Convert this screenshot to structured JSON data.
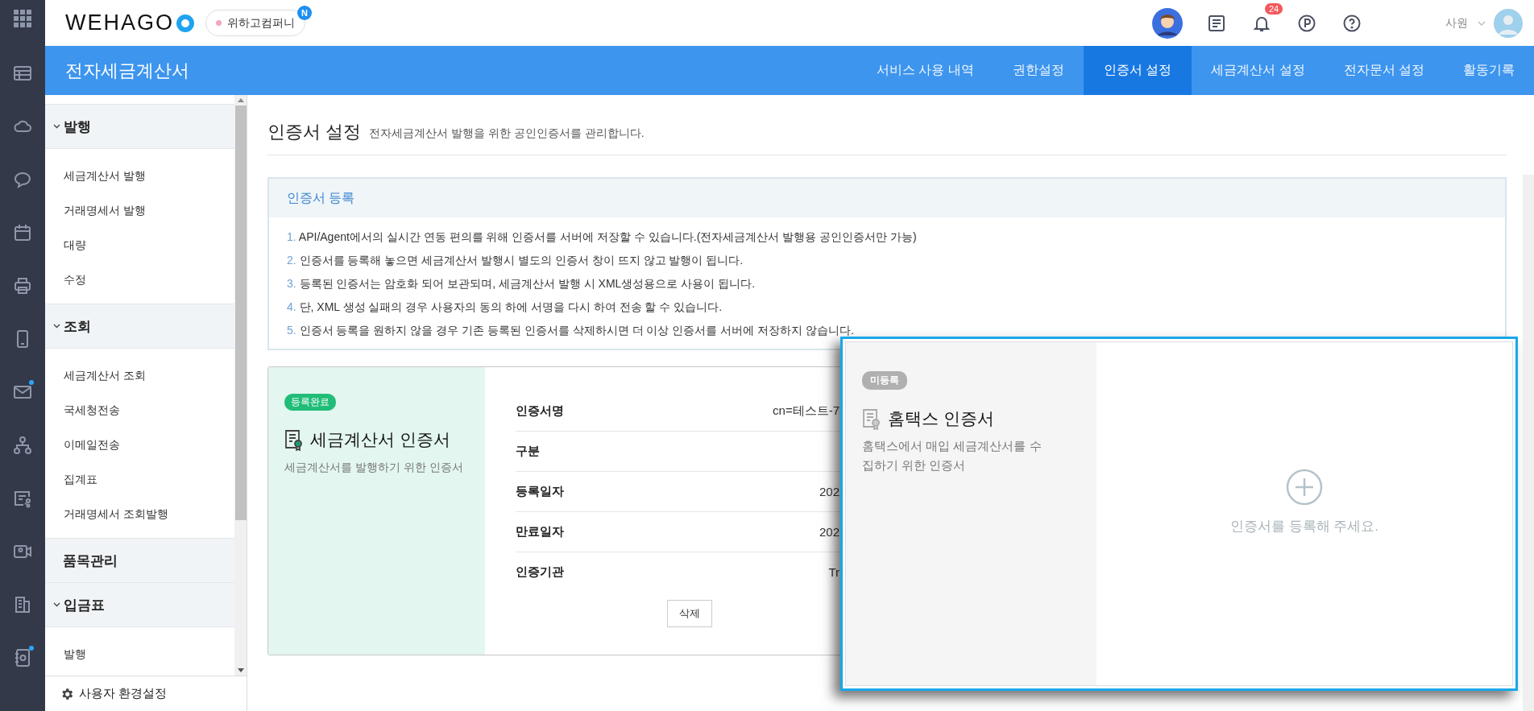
{
  "rail": [
    {
      "notification": false
    },
    {
      "notification": false
    },
    {
      "notification": false
    },
    {
      "notification": false
    },
    {
      "notification": false
    },
    {
      "notification": false
    },
    {
      "notification": false
    },
    {
      "notification": true
    },
    {
      "notification": false
    },
    {
      "notification": false
    },
    {
      "notification": false
    },
    {
      "notification": false
    },
    {
      "notification": true
    }
  ],
  "topbar": {
    "logo": "WEHAGO",
    "company": "위하고컴퍼니",
    "company_badge": "N",
    "notification_count": "24",
    "user_role": "사원"
  },
  "header": {
    "title": "전자세금계산서",
    "tabs": [
      {
        "label": "서비스 사용 내역",
        "selected": false
      },
      {
        "label": "권한설정",
        "selected": false
      },
      {
        "label": "인증서 설정",
        "selected": true
      },
      {
        "label": "세금계산서 설정",
        "selected": false
      },
      {
        "label": "전자문서 설정",
        "selected": false
      },
      {
        "label": "활동기록",
        "selected": false
      }
    ]
  },
  "sidebar": {
    "groups": [
      {
        "label": "발행",
        "kind": "folder",
        "items": [
          "세금계산서 발행",
          "거래명세서 발행",
          "대량",
          "수정"
        ]
      },
      {
        "label": "조회",
        "kind": "folder",
        "items": [
          "세금계산서 조회",
          "국세청전송",
          "이메일전송",
          "집계표",
          "거래명세서 조회발행"
        ]
      },
      {
        "label": "품목관리",
        "kind": "link"
      },
      {
        "label": "입금표",
        "kind": "folder",
        "items": [
          "발행"
        ]
      }
    ],
    "footer": "사용자 환경설정"
  },
  "page": {
    "title": "인증서 설정",
    "subtitle": "전자세금계산서 발행을 위한 공인인증서를 관리합니다."
  },
  "info": {
    "title": "인증서 등록",
    "lines": [
      {
        "num": "1.",
        "text": "API/Agent에서의 실시간 연동 편의를 위해 인증서를 서버에 저장할 수 있습니다.(전자세금계산서 발행용 공인인증서만 가능)"
      },
      {
        "num": "2.",
        "text": "인증서를 등록해 놓으면 세금계산서 발행시 별도의 인증서 창이 뜨지 않고 발행이 됩니다."
      },
      {
        "num": "3.",
        "text": "등록된 인증서는 암호화 되어 보관되며, 세금계산서 발행 시 XML생성용으로 사용이 됩니다."
      },
      {
        "num": "4.",
        "text": "단, XML 생성 실패의 경우 사용자의 동의 하에 서명을 다시 하여 전송 할 수 있습니다."
      },
      {
        "num": "5.",
        "text": "인증서 등록을 원하지 않을 경우 기존 등록된 인증서를 삭제하시면 더 이상 인증서를 서버에 저장하지 않습니다."
      }
    ]
  },
  "cards": [
    {
      "kind": "registered",
      "highlighted": false,
      "status": "등록완료",
      "title": "세금계산서 인증서",
      "description": "세금계산서를 발행하기 위한 인증서",
      "fields": [
        {
          "label": "인증서명",
          "value": "cn=테스트-7"
        },
        {
          "label": "구분"
        },
        {
          "label": "등록일자",
          "value": "202"
        },
        {
          "label": "만료일자",
          "value": "202"
        },
        {
          "label": "인증기관",
          "value": "Tr"
        }
      ],
      "button": "삭제"
    },
    {
      "kind": "unregistered",
      "highlighted": true,
      "status": "미등록",
      "title": "홈택스 인증서",
      "description": "홈택스에서 매입 세금계산서를 수집하기 위한 인증서",
      "prompt": "인증서를 등록해 주세요."
    }
  ]
}
